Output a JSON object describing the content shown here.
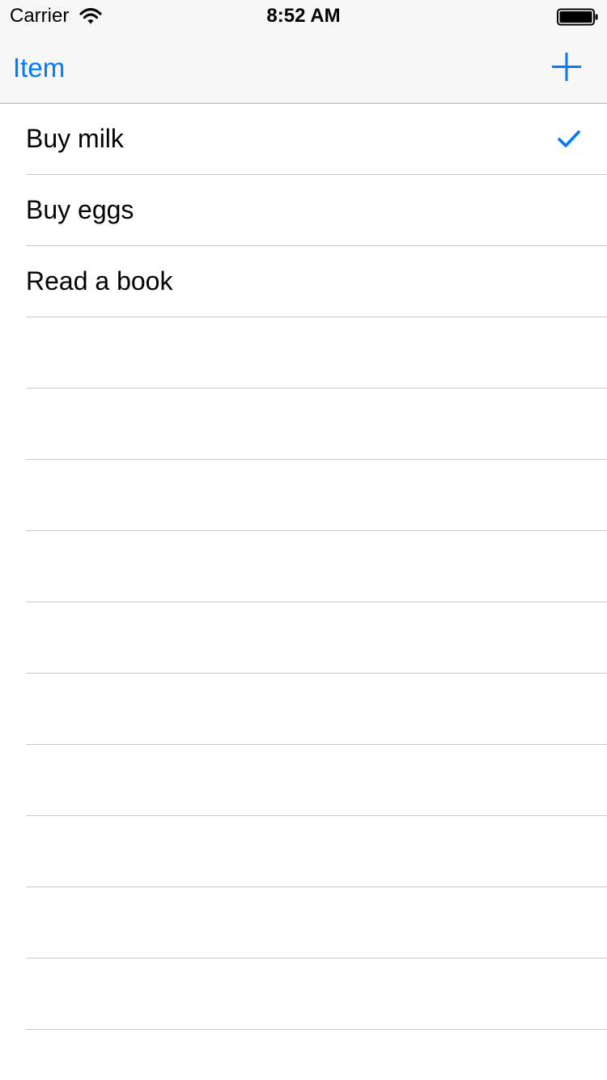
{
  "status_bar": {
    "carrier": "Carrier",
    "time": "8:52 AM",
    "wifi_icon": "wifi-icon",
    "battery_icon": "battery-full-icon"
  },
  "nav_bar": {
    "title": "Item",
    "add_icon": "plus-icon"
  },
  "list": {
    "items": [
      {
        "label": "Buy milk",
        "checked": true
      },
      {
        "label": "Buy eggs",
        "checked": false
      },
      {
        "label": "Read a book",
        "checked": false
      }
    ],
    "empty_row_count": 10
  },
  "colors": {
    "accent": "#007aff",
    "nav_background": "#f7f7f7",
    "separator": "#c8c7cc",
    "text": "#000000"
  }
}
